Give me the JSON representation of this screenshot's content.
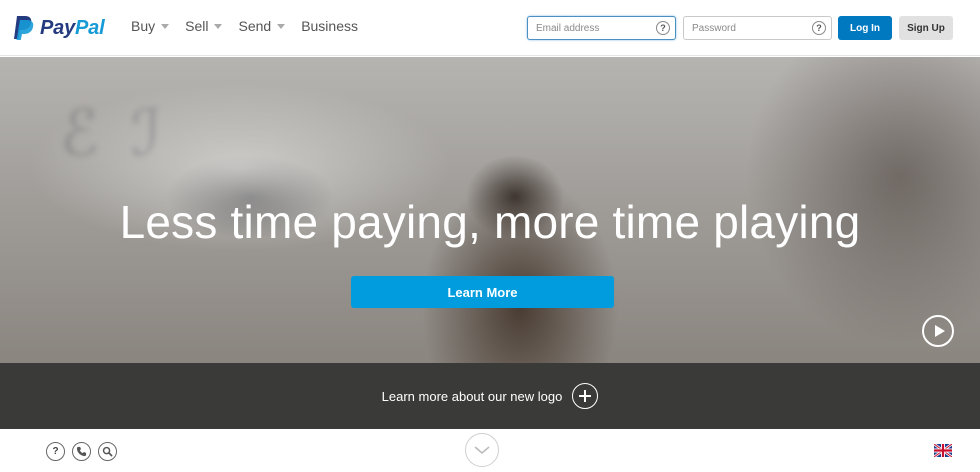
{
  "header": {
    "brand": {
      "pay": "Pay",
      "pal": "Pal"
    },
    "nav": [
      {
        "label": "Buy",
        "has_dropdown": true
      },
      {
        "label": "Sell",
        "has_dropdown": true
      },
      {
        "label": "Send",
        "has_dropdown": true
      },
      {
        "label": "Business",
        "has_dropdown": false
      }
    ],
    "email_placeholder": "Email address",
    "password_placeholder": "Password",
    "help_glyph": "?",
    "login_label": "Log In",
    "signup_label": "Sign Up"
  },
  "hero": {
    "title": "Less time paying, more time playing",
    "cta_label": "Learn More",
    "play_icon": "play-icon"
  },
  "logo_band": {
    "text": "Learn more about our new logo",
    "icon": "plus-circle-icon"
  },
  "footer": {
    "help_glyph": "?",
    "icons": [
      "help-icon",
      "phone-icon",
      "search-icon",
      "chevron-down-icon",
      "uk-flag-icon"
    ]
  },
  "colors": {
    "brand_dark": "#253b80",
    "brand_light": "#179bd7",
    "login_button": "#0079c1",
    "cta_button": "#009cde",
    "band": "#3a3a39"
  }
}
